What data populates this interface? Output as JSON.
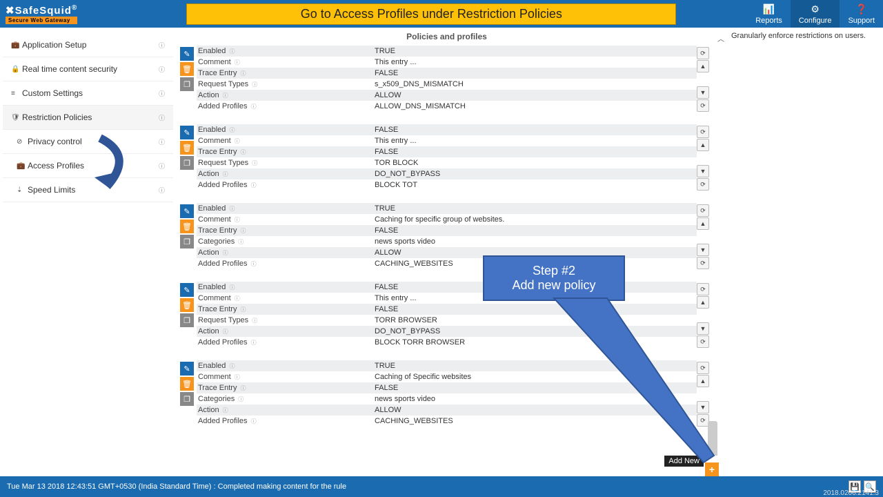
{
  "header": {
    "logo_main": "✖SafeSquid",
    "logo_reg": "®",
    "logo_sub": "Secure Web Gateway",
    "banner": "Go to Access Profiles under Restriction Policies",
    "nav": [
      {
        "icon": "📊",
        "label": "Reports"
      },
      {
        "icon": "⚙",
        "label": "Configure"
      },
      {
        "icon": "❓",
        "label": "Support"
      }
    ]
  },
  "sidebar": [
    {
      "icon": "💼",
      "label": "Application Setup",
      "sub": false
    },
    {
      "icon": "🔒",
      "label": "Real time content security",
      "sub": false
    },
    {
      "icon": "≡",
      "label": "Custom Settings",
      "sub": false
    },
    {
      "icon": "🛡",
      "label": "Restriction Policies",
      "sub": false
    },
    {
      "icon": "⊘",
      "label": "Privacy control",
      "sub": true
    },
    {
      "icon": "💼",
      "label": "Access Profiles",
      "sub": true
    },
    {
      "icon": "⇣",
      "label": "Speed Limits",
      "sub": true
    }
  ],
  "section_title": "Policies and profiles",
  "right_text": "Granularly enforce restrictions on users.",
  "policies": [
    {
      "rows": [
        {
          "k": "Enabled",
          "v": "TRUE",
          "z": true
        },
        {
          "k": "Comment",
          "v": "This entry ...",
          "z": false
        },
        {
          "k": "Trace Entry",
          "v": "FALSE",
          "z": true
        },
        {
          "k": "Request Types",
          "v": "s_x509_DNS_MISMATCH",
          "z": false
        },
        {
          "k": "Action",
          "v": "ALLOW",
          "z": true
        },
        {
          "k": "Added Profiles",
          "v": "ALLOW_DNS_MISMATCH",
          "z": false
        }
      ]
    },
    {
      "rows": [
        {
          "k": "Enabled",
          "v": "FALSE",
          "z": true
        },
        {
          "k": "Comment",
          "v": "This entry ...",
          "z": false
        },
        {
          "k": "Trace Entry",
          "v": "FALSE",
          "z": true
        },
        {
          "k": "Request Types",
          "v": "TOR BLOCK",
          "z": false
        },
        {
          "k": "Action",
          "v": "DO_NOT_BYPASS",
          "z": true
        },
        {
          "k": "Added Profiles",
          "v": "BLOCK TOT",
          "z": false
        }
      ]
    },
    {
      "rows": [
        {
          "k": "Enabled",
          "v": "TRUE",
          "z": true
        },
        {
          "k": "Comment",
          "v": "Caching for specific group of websites.",
          "z": false
        },
        {
          "k": "Trace Entry",
          "v": "FALSE",
          "z": true
        },
        {
          "k": "Categories",
          "v": "news  sports  video",
          "z": false
        },
        {
          "k": "Action",
          "v": "ALLOW",
          "z": true
        },
        {
          "k": "Added Profiles",
          "v": "CACHING_WEBSITES",
          "z": false
        }
      ]
    },
    {
      "rows": [
        {
          "k": "Enabled",
          "v": "FALSE",
          "z": true
        },
        {
          "k": "Comment",
          "v": "This entry ...",
          "z": false
        },
        {
          "k": "Trace Entry",
          "v": "FALSE",
          "z": true
        },
        {
          "k": "Request Types",
          "v": "TORR BROWSER",
          "z": false
        },
        {
          "k": "Action",
          "v": "DO_NOT_BYPASS",
          "z": true
        },
        {
          "k": "Added Profiles",
          "v": "BLOCK TORR BROWSER",
          "z": false
        }
      ]
    },
    {
      "rows": [
        {
          "k": "Enabled",
          "v": "TRUE",
          "z": true
        },
        {
          "k": "Comment",
          "v": "Caching of Specific websites",
          "z": false
        },
        {
          "k": "Trace Entry",
          "v": "FALSE",
          "z": true
        },
        {
          "k": "Categories",
          "v": "news  sports  video",
          "z": false
        },
        {
          "k": "Action",
          "v": "ALLOW",
          "z": true
        },
        {
          "k": "Added Profiles",
          "v": "CACHING_WEBSITES",
          "z": false
        }
      ]
    }
  ],
  "add_tooltip": "Add New",
  "callout": {
    "line1": "Step #2",
    "line2": "Add new policy"
  },
  "footer": {
    "status": "Tue Mar 13 2018 12:43:51 GMT+0530 (India Standard Time) : Completed making content for the rule",
    "version": "2018.0206.2141.3"
  }
}
